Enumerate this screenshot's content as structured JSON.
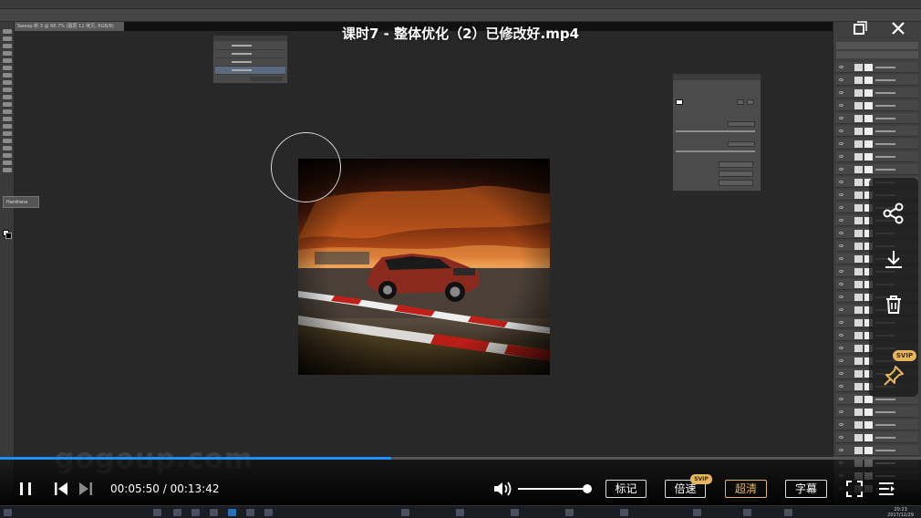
{
  "video": {
    "title": "课时7 - 整体优化（2）已修改好.mp4",
    "current_time": "00:05:50",
    "total_time": "00:13:42",
    "time_display": "00:05:50 / 00:13:42",
    "progress_fraction": 0.425,
    "volume_fraction": 0.93,
    "watermark": "gogoup.com"
  },
  "player_buttons": {
    "mark_label": "标记",
    "speed_label": "倍速",
    "speed_badge": "SVIP",
    "quality_label": "超清",
    "subtitle_label": "字幕",
    "pin_badge": "SVIP"
  },
  "colors": {
    "progress": "#1e8fff",
    "svip_gold": "#e6b55c"
  },
  "photoshop": {
    "doc_tab": "Sweep 新 3 @ 66.7% (图层 11 拷贝, RGB/8)",
    "brush_flyout": "Hardness"
  },
  "taskbar": {
    "clock_time": "20:23",
    "clock_date": "2017/12/29"
  },
  "icons": {
    "share": "share-icon",
    "download": "download-icon",
    "delete": "trash-icon",
    "pin": "pin-icon",
    "play_pause": "pause-icon",
    "prev": "skip-back-icon",
    "next": "skip-forward-icon",
    "volume": "volume-icon",
    "fullscreen": "fullscreen-icon",
    "playlist": "playlist-icon",
    "window_restore": "restore-icon",
    "window_close": "close-icon"
  }
}
